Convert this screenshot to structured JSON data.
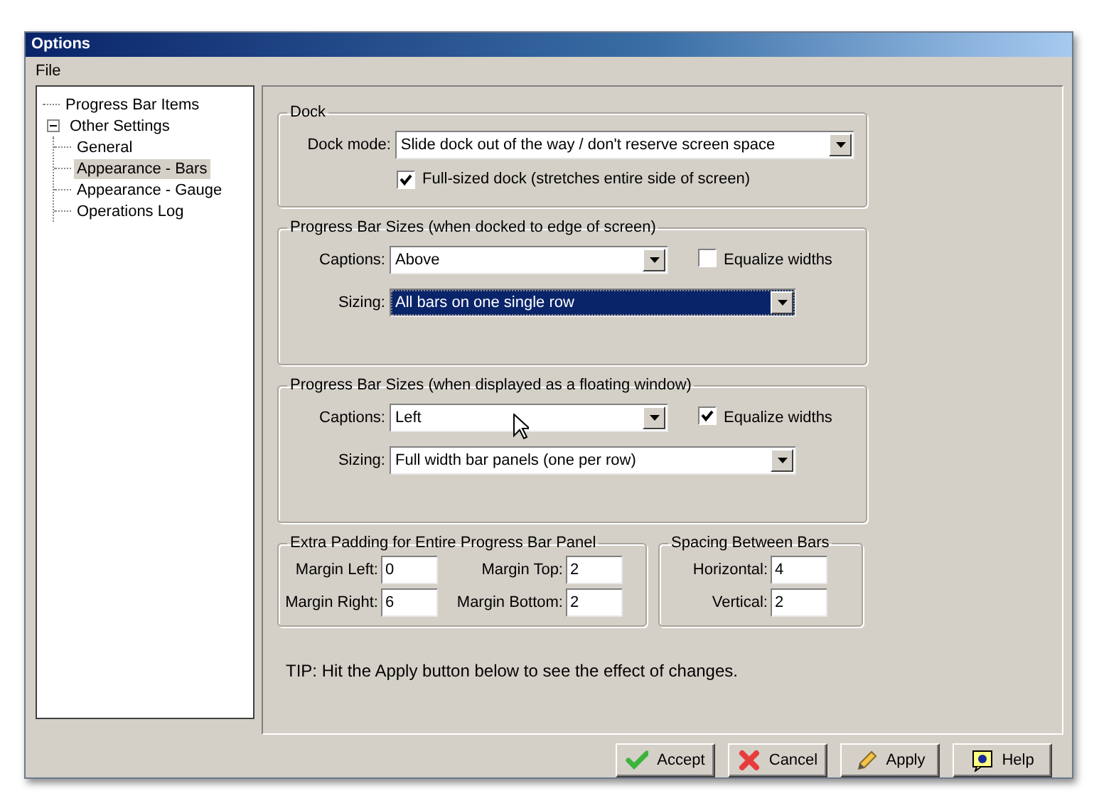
{
  "window": {
    "title": "Options"
  },
  "menu": [
    {
      "label": "File"
    }
  ],
  "tree": [
    {
      "label": "Progress Bar Items",
      "selected": false
    },
    {
      "label": "Other Settings",
      "selected": false,
      "expanded": true,
      "children": [
        {
          "label": "General",
          "selected": false
        },
        {
          "label": "Appearance - Bars",
          "selected": true
        },
        {
          "label": "Appearance - Gauge",
          "selected": false
        },
        {
          "label": "Operations Log",
          "selected": false
        }
      ]
    }
  ],
  "dock": {
    "title": "Dock",
    "mode_label": "Dock mode:",
    "mode_value": "Slide dock out of the way / don't reserve screen space",
    "full_sized": {
      "label": "Full-sized dock (stretches entire side of screen)",
      "checked": true
    }
  },
  "size_groups": [
    {
      "title": "Progress Bar Sizes  (when docked to edge of screen)",
      "captions_label": "Captions:",
      "captions_value": "Above",
      "captions_focused": false,
      "equalize": {
        "label": "Equalize widths",
        "checked": false
      },
      "sizing_label": "Sizing:",
      "sizing_value": "All bars on one single row",
      "sizing_focused": true
    },
    {
      "title": "Progress Bar Sizes (when displayed as a floating window)",
      "captions_label": "Captions:",
      "captions_value": "Left",
      "captions_focused": false,
      "equalize": {
        "label": "Equalize widths",
        "checked": true
      },
      "sizing_label": "Sizing:",
      "sizing_value": "Full width bar panels (one per row)",
      "sizing_focused": false
    }
  ],
  "padding": {
    "title": "Extra Padding for Entire Progress Bar Panel",
    "fields": [
      {
        "label": "Margin Left:",
        "value": "0"
      },
      {
        "label": "Margin Top:",
        "value": "2"
      },
      {
        "label": "Margin Right:",
        "value": "6"
      },
      {
        "label": "Margin Bottom:",
        "value": "2"
      }
    ]
  },
  "spacing": {
    "title": "Spacing Between Bars",
    "fields": [
      {
        "label": "Horizontal:",
        "value": "4"
      },
      {
        "label": "Vertical:",
        "value": "2"
      }
    ]
  },
  "tip": "TIP: Hit the Apply button below to see the effect of changes.",
  "buttons": [
    {
      "label": "Accept",
      "kind": "accept"
    },
    {
      "label": "Cancel",
      "kind": "cancel"
    },
    {
      "label": "Apply",
      "kind": "apply"
    },
    {
      "label": "Help",
      "kind": "help"
    }
  ]
}
